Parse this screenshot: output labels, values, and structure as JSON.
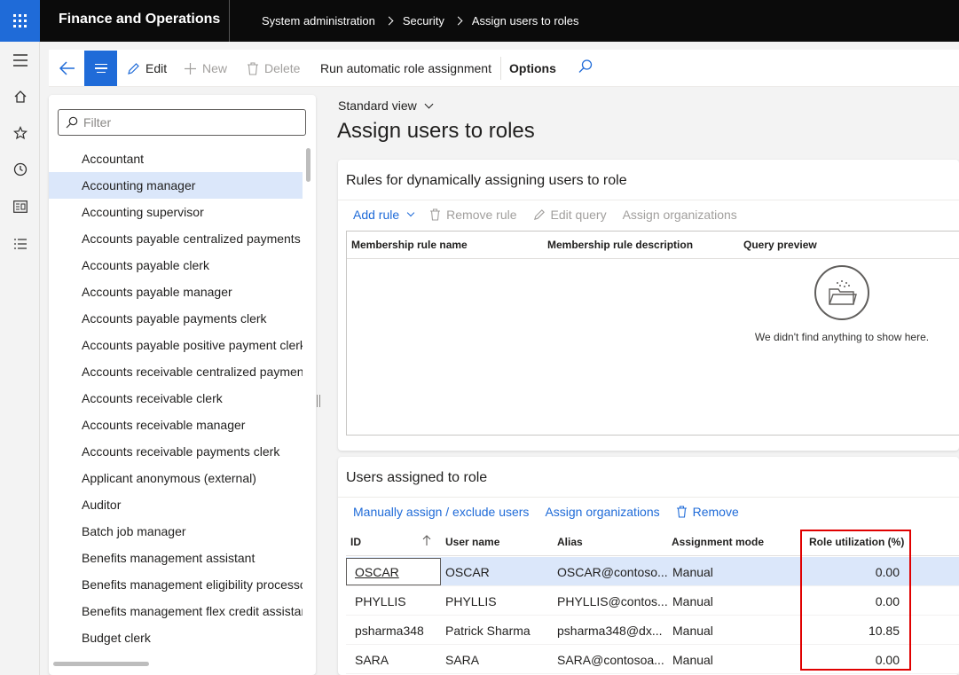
{
  "topbar": {
    "app_title": "Finance and Operations",
    "breadcrumbs": [
      "System administration",
      "Security",
      "Assign users to roles"
    ]
  },
  "rail": {
    "icons": [
      "hamburger-icon",
      "home-icon",
      "star-icon",
      "clock-icon",
      "workspace-icon",
      "list-icon"
    ]
  },
  "actionpane": {
    "edit": "Edit",
    "new": "New",
    "delete": "Delete",
    "run": "Run automatic role assignment",
    "options": "Options"
  },
  "filter": {
    "placeholder": "Filter"
  },
  "roles": [
    "Accountant",
    "Accounting manager",
    "Accounting supervisor",
    "Accounts payable centralized payments clerk",
    "Accounts payable clerk",
    "Accounts payable manager",
    "Accounts payable payments clerk",
    "Accounts payable positive payment clerk",
    "Accounts receivable centralized payments clerk",
    "Accounts receivable clerk",
    "Accounts receivable manager",
    "Accounts receivable payments clerk",
    "Applicant anonymous (external)",
    "Auditor",
    "Batch job manager",
    "Benefits management assistant",
    "Benefits management eligibility processor",
    "Benefits management flex credit assistant",
    "Budget clerk"
  ],
  "selected_role_index": 1,
  "main": {
    "view": "Standard view",
    "title": "Assign users to roles"
  },
  "rules_card": {
    "title": "Rules for dynamically assigning users to role",
    "toolbar": {
      "add_rule": "Add rule",
      "remove_rule": "Remove rule",
      "edit_query": "Edit query",
      "assign_orgs": "Assign organizations"
    },
    "columns": [
      "Membership rule name",
      "Membership rule description",
      "Query preview"
    ],
    "empty_message": "We didn't find anything to show here."
  },
  "users_card": {
    "title": "Users assigned to role",
    "toolbar": {
      "manual": "Manually assign / exclude users",
      "assign_orgs": "Assign organizations",
      "remove": "Remove"
    },
    "columns": [
      "ID",
      "User name",
      "Alias",
      "Assignment mode",
      "Role utilization (%)"
    ],
    "rows": [
      {
        "id": "OSCAR",
        "name": "OSCAR",
        "alias": "OSCAR@contoso...",
        "mode": "Manual",
        "util": "0.00"
      },
      {
        "id": "PHYLLIS",
        "name": "PHYLLIS",
        "alias": "PHYLLIS@contos...",
        "mode": "Manual",
        "util": "0.00"
      },
      {
        "id": "psharma348",
        "name": "Patrick Sharma",
        "alias": "psharma348@dx...",
        "mode": "Manual",
        "util": "10.85"
      },
      {
        "id": "SARA",
        "name": "SARA",
        "alias": "SARA@contosoa...",
        "mode": "Manual",
        "util": "0.00"
      }
    ]
  },
  "colors": {
    "accent": "#1f6bd8",
    "topbar": "#0b0b0b",
    "highlight": "#e00000",
    "selected_row": "#dbe7fa"
  }
}
